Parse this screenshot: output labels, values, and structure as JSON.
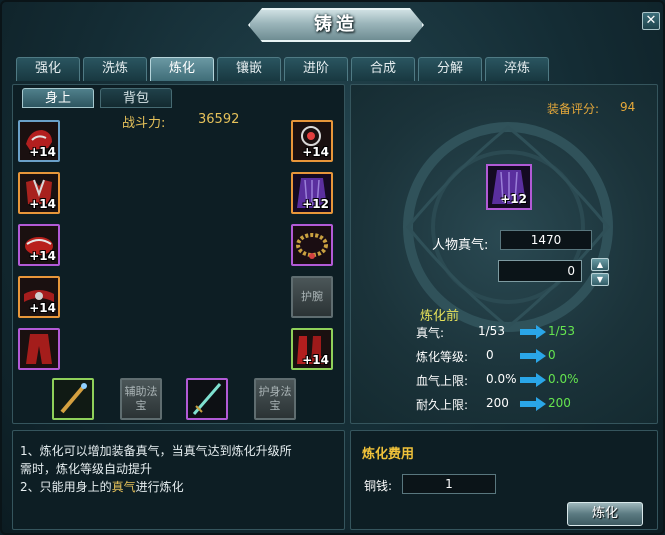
{
  "window": {
    "title": "铸造",
    "close_label": "✕"
  },
  "tabs": [
    {
      "label": "强化",
      "active": false
    },
    {
      "label": "洗炼",
      "active": false
    },
    {
      "label": "炼化",
      "active": true
    },
    {
      "label": "镶嵌",
      "active": false
    },
    {
      "label": "进阶",
      "active": false
    },
    {
      "label": "合成",
      "active": false
    },
    {
      "label": "分解",
      "active": false
    },
    {
      "label": "淬炼",
      "active": false
    }
  ],
  "subtabs": [
    {
      "label": "身上",
      "active": true
    },
    {
      "label": "背包",
      "active": false
    }
  ],
  "power": {
    "label": "战斗力:",
    "value": "36592"
  },
  "equipment_left": [
    {
      "plus": "+14",
      "frame": "blue"
    },
    {
      "plus": "+14",
      "frame": "orange"
    },
    {
      "plus": "+14",
      "frame": "purple"
    },
    {
      "plus": "+14",
      "frame": "orange"
    },
    {
      "plus": "",
      "frame": "purple"
    }
  ],
  "equipment_right": [
    {
      "plus": "+14",
      "frame": "orange",
      "empty_label": ""
    },
    {
      "plus": "+12",
      "frame": "orange",
      "empty_label": ""
    },
    {
      "plus": "",
      "frame": "purple",
      "empty_label": ""
    },
    {
      "plus": "",
      "frame": "empty",
      "empty_label": "护腕"
    },
    {
      "plus": "+14",
      "frame": "green",
      "empty_label": ""
    }
  ],
  "equipment_bottom": [
    {
      "plus": "",
      "frame": "green",
      "empty_label": ""
    },
    {
      "plus": "",
      "frame": "empty",
      "empty_label": "辅助法宝"
    },
    {
      "plus": "",
      "frame": "purple",
      "empty_label": ""
    },
    {
      "plus": "",
      "frame": "empty",
      "empty_label": "护身法宝"
    }
  ],
  "score": {
    "label": "装备评分:",
    "value": "94"
  },
  "forge_item": {
    "plus": "+12"
  },
  "zhenqi": {
    "label": "人物真气:",
    "value": "1470"
  },
  "quantity": {
    "value": "0"
  },
  "before": {
    "label": "炼化前",
    "stats": [
      {
        "name": "真气:",
        "from": "1/53",
        "to": "1/53"
      },
      {
        "name": "炼化等级:",
        "from": "0",
        "to": "0"
      },
      {
        "name": "血气上限:",
        "from": "0.0%",
        "to": "0.0%"
      },
      {
        "name": "耐久上限:",
        "from": "200",
        "to": "200"
      }
    ]
  },
  "description": {
    "line1": "1、炼化可以增加装备真气，当真气达到炼化升级所",
    "line2": "需时，炼化等级自动提升",
    "line3_pre": "2、只能用身上的",
    "line3_hl": "真气",
    "line3_post": "进行炼化"
  },
  "cost": {
    "title": "炼化费用",
    "label": "铜钱:",
    "value": "1"
  },
  "forge_button": {
    "label": "炼化"
  },
  "colors": {
    "gold": "#e5c15a",
    "green_value": "#65e54f",
    "orange_frame": "#e7963a",
    "purple_frame": "#b25ad6"
  }
}
